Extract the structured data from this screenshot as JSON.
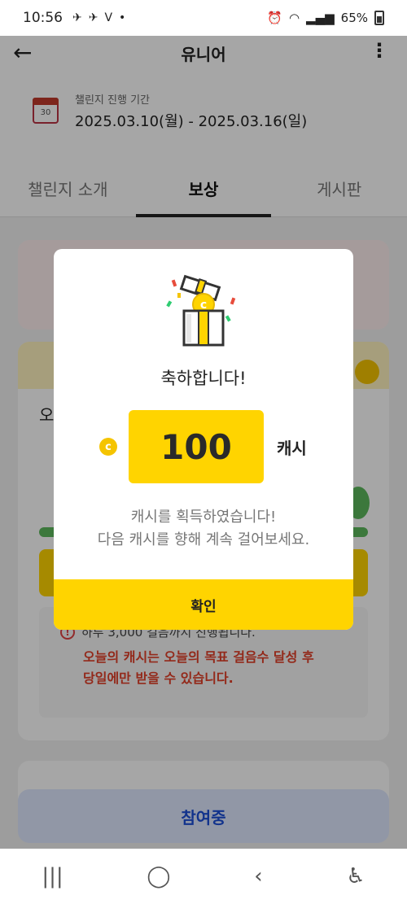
{
  "status_bar": {
    "time": "10:56",
    "battery": "65%",
    "dot": "•"
  },
  "app_bar": {
    "back_icon": "←",
    "title": "유니어",
    "more_icon": "⋮"
  },
  "period": {
    "label": "챌린지 진행 기간",
    "dates": "2025.03.10(월) - 2025.03.16(일)",
    "calendar_day": "30"
  },
  "tabs": [
    {
      "label": "챌린지 소개",
      "active": false
    },
    {
      "label": "보상",
      "active": true
    },
    {
      "label": "게시판",
      "active": false
    }
  ],
  "background": {
    "today_label": "오",
    "info_line": "하루 3,000 걸음까지 진행됩니다.",
    "info_red": "오늘의 캐시는 오늘의 목표 걸음수 달성 후\n당일에만 받을 수 있습니다.",
    "cta_label": "참여중"
  },
  "modal": {
    "title": "축하합니다!",
    "amount": "100",
    "unit": "캐시",
    "coin_symbol": "c",
    "message_line1": "캐시를 획득하였습니다!",
    "message_line2": "다음 캐시를 향해 계속 걸어보세요.",
    "confirm_label": "확인"
  },
  "nav_bar": {
    "recents": "|||",
    "home": "◯",
    "back": "‹",
    "accessibility": "♿"
  },
  "colors": {
    "accent_yellow": "#ffd400",
    "cta_blue": "#1d4fd8",
    "warning_red": "#e23f28"
  }
}
